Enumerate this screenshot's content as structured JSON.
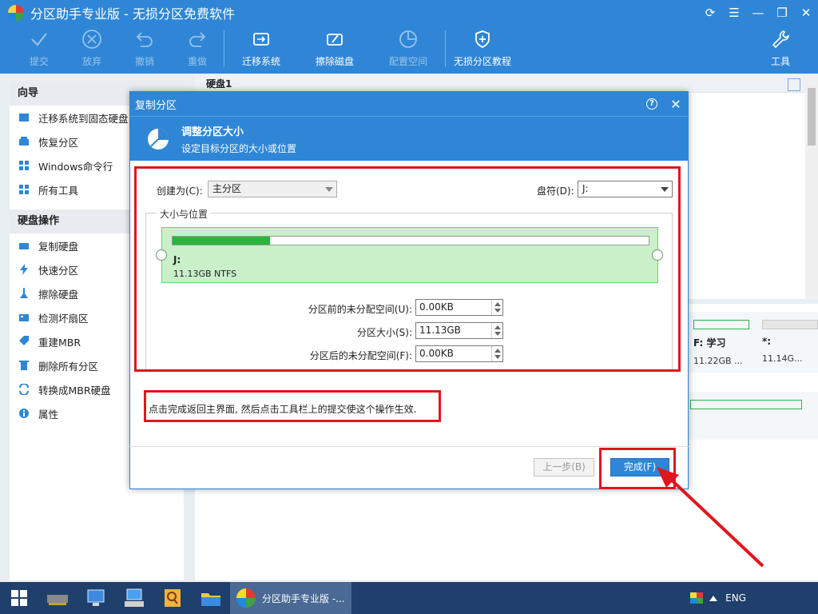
{
  "window": {
    "title": "分区助手专业版 - 无损分区免费软件"
  },
  "toolbar": {
    "commit": "提交",
    "discard": "放弃",
    "undo": "撤销",
    "redo": "重做",
    "migrate_os": "迁移系统",
    "wipe_disk": "擦除磁盘",
    "config_space": "配置空间",
    "tutorial": "无损分区教程",
    "tools": "工具"
  },
  "sidebar": {
    "wizard_title": "向导",
    "wizard_items": [
      "迁移系统到固态硬盘",
      "恢复分区",
      "Windows命令行",
      "所有工具"
    ],
    "disk_ops_title": "硬盘操作",
    "disk_ops_items": [
      "复制硬盘",
      "快速分区",
      "擦除硬盘",
      "检测坏扇区",
      "重建MBR",
      "删除所有分区",
      "转换成MBR硬盘",
      "属性"
    ]
  },
  "main": {
    "disk_header": "硬盘1",
    "partitions": [
      {
        "label": "F: 学习",
        "size": "11.22GB ..."
      },
      {
        "label": "*:",
        "size": "11.14G..."
      }
    ]
  },
  "dialog": {
    "title": "复制分区",
    "help": "?",
    "banner_title": "调整分区大小",
    "banner_subtitle": "设定目标分区的大小或位置",
    "create_as_label": "创建为(C):",
    "create_as_value": "主分区",
    "drive_letter_label": "盘符(D):",
    "drive_letter_value": "J:",
    "group_title": "大小与位置",
    "partition_name": "J:",
    "partition_info": "11.13GB NTFS",
    "partition_fill_fraction": 0.205,
    "unalloc_before_label": "分区前的未分配空间(U):",
    "unalloc_before_value": "0.00KB",
    "size_label": "分区大小(S):",
    "size_value": "11.13GB",
    "unalloc_after_label": "分区后的未分配空间(F):",
    "unalloc_after_value": "0.00KB",
    "hint": "点击完成返回主界面, 然后点击工具栏上的提交使这个操作生效.",
    "back_button": "上一步(B)",
    "finish_button": "完成(F)"
  },
  "taskbar": {
    "active_app": "分区助手专业版 -...",
    "lang": "ENG"
  },
  "colors": {
    "accent": "#2f86d6",
    "highlight_red": "#e0161e",
    "partition_green": "#28b63e"
  }
}
